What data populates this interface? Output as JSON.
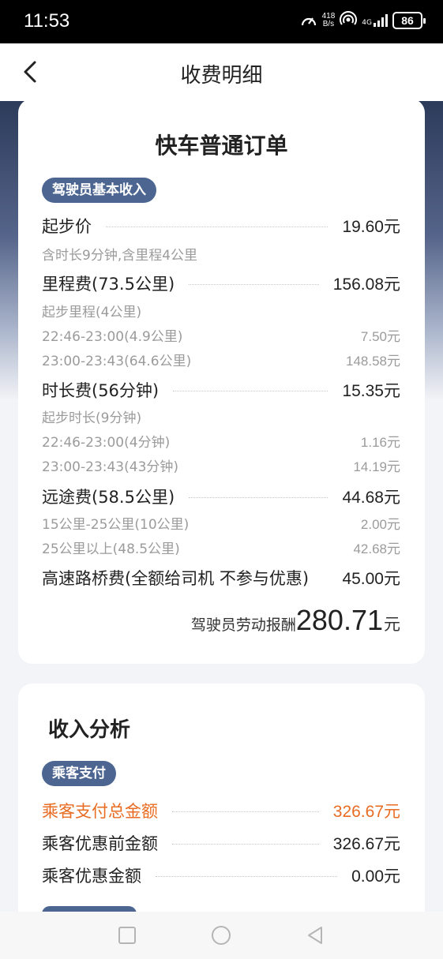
{
  "status_bar": {
    "time": "11:53",
    "net_speed_value": "418",
    "net_speed_unit": "B/s",
    "signal_tag_top": "4G",
    "battery": "86"
  },
  "nav": {
    "title": "收费明细"
  },
  "main_card": {
    "title": "快车普通订单",
    "section_pill": "驾驶员基本收入",
    "base_fare": {
      "label": "起步价",
      "value": "19.60元",
      "note": "含时长9分钟,含里程4公里"
    },
    "mileage": {
      "label": "里程费(73.5公里)",
      "value": "156.08元",
      "items": [
        {
          "label": "起步里程(4公里)",
          "value": ""
        },
        {
          "label": "22:46-23:00(4.9公里)",
          "value": "7.50元"
        },
        {
          "label": "23:00-23:43(64.6公里)",
          "value": "148.58元"
        }
      ]
    },
    "duration": {
      "label": "时长费(56分钟)",
      "value": "15.35元",
      "items": [
        {
          "label": "起步时长(9分钟)",
          "value": ""
        },
        {
          "label": "22:46-23:00(4分钟)",
          "value": "1.16元"
        },
        {
          "label": "23:00-23:43(43分钟)",
          "value": "14.19元"
        }
      ]
    },
    "long_distance": {
      "label": "远途费(58.5公里)",
      "value": "44.68元",
      "items": [
        {
          "label": "15公里-25公里(10公里)",
          "value": "2.00元"
        },
        {
          "label": "25公里以上(48.5公里)",
          "value": "42.68元"
        }
      ]
    },
    "toll": {
      "label": "高速路桥费(全额给司机 不参与优惠)",
      "value": "45.00元"
    },
    "total": {
      "label": "驾驶员劳动报酬",
      "amount": "280.71",
      "unit": "元"
    }
  },
  "analysis_card": {
    "title": "收入分析",
    "section_pill": "乘客支付",
    "rows": [
      {
        "label": "乘客支付总金额",
        "value": "326.67元"
      },
      {
        "label": "乘客优惠前金额",
        "value": "326.67元"
      },
      {
        "label": "乘客优惠金额",
        "value": "0.00元"
      }
    ]
  },
  "colors": {
    "accent_orange": "#e86c22",
    "pill_blue": "#4c6691",
    "header_gradient_top": "#2c3b5a"
  },
  "icons": {
    "back": "chevron-left",
    "sys_recent": "square",
    "sys_home": "circle",
    "sys_back": "triangle-left"
  }
}
